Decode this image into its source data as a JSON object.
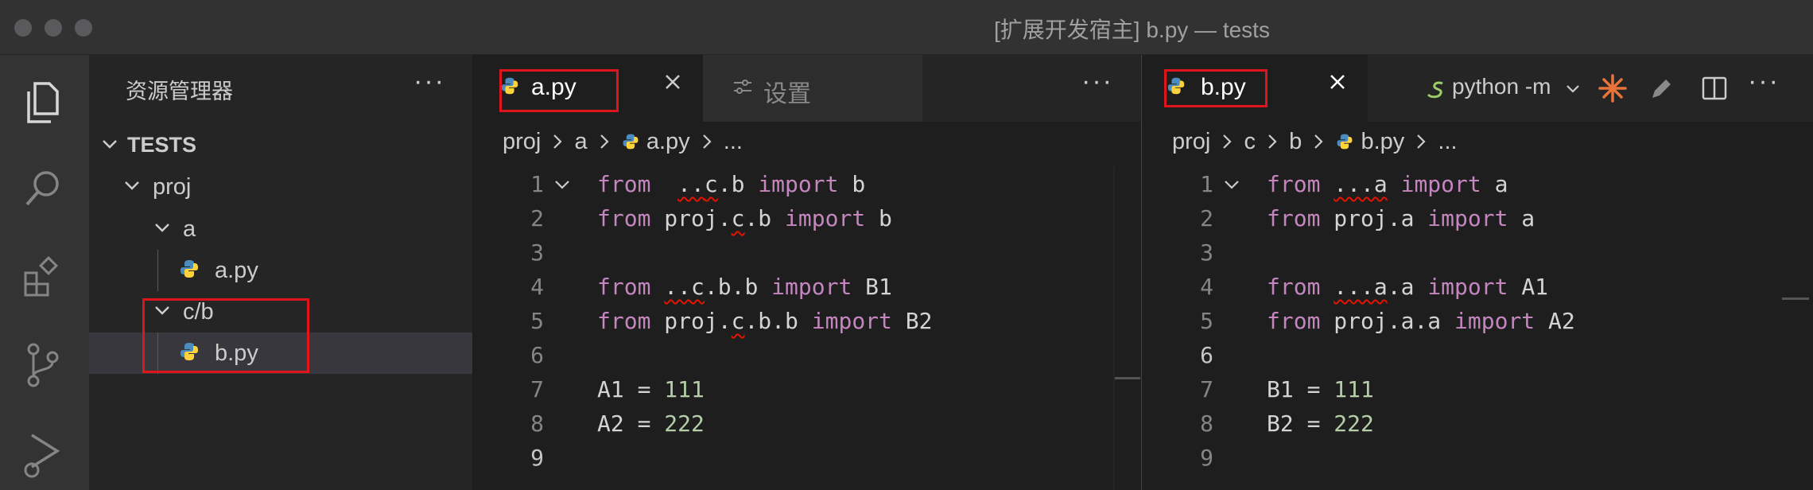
{
  "window": {
    "title": "[扩展开发宿主] b.py — tests"
  },
  "activity_bar": {
    "icons": [
      "files-icon",
      "search-icon",
      "extensions-icon",
      "source-control-icon",
      "run-debug-icon"
    ]
  },
  "sidebar": {
    "title": "资源管理器",
    "more": "···",
    "root": "TESTS",
    "tree": {
      "proj": "proj",
      "a": "a",
      "a_py": "a.py",
      "cb": "c/b",
      "b_py": "b.py"
    }
  },
  "left_editor": {
    "tabs": [
      {
        "label": "a.py",
        "active": true,
        "icon": "python-icon"
      },
      {
        "label": "设置",
        "active": false,
        "icon": "settings-sliders-icon"
      }
    ],
    "more": "···",
    "breadcrumb": [
      "proj",
      "a",
      "a.py",
      "..."
    ],
    "lines": [
      {
        "n": "1",
        "parts": [
          [
            "kw",
            "from"
          ],
          [
            "",
            "  "
          ],
          [
            "sq",
            ".."
          ],
          [
            "sq",
            "c"
          ],
          [
            "",
            ".b "
          ],
          [
            "kw",
            "import"
          ],
          [
            "",
            " b"
          ]
        ]
      },
      {
        "n": "2",
        "parts": [
          [
            "kw",
            "from"
          ],
          [
            "",
            " proj."
          ],
          [
            "sq",
            "c"
          ],
          [
            "",
            ".b "
          ],
          [
            "kw",
            "import"
          ],
          [
            "",
            " b"
          ]
        ]
      },
      {
        "n": "3",
        "parts": []
      },
      {
        "n": "4",
        "parts": [
          [
            "kw",
            "from"
          ],
          [
            "",
            " "
          ],
          [
            "sq",
            ".."
          ],
          [
            "sq",
            "c"
          ],
          [
            "",
            ".b.b "
          ],
          [
            "kw",
            "import"
          ],
          [
            "",
            " B1"
          ]
        ]
      },
      {
        "n": "5",
        "parts": [
          [
            "kw",
            "from"
          ],
          [
            "",
            " proj."
          ],
          [
            "sq",
            "c"
          ],
          [
            "",
            ".b.b "
          ],
          [
            "kw",
            "import"
          ],
          [
            "",
            " B2"
          ]
        ]
      },
      {
        "n": "6",
        "parts": []
      },
      {
        "n": "7",
        "parts": [
          [
            "",
            "A1 = "
          ],
          [
            "num",
            "111"
          ]
        ]
      },
      {
        "n": "8",
        "parts": [
          [
            "",
            "A2 = "
          ],
          [
            "num",
            "222"
          ]
        ]
      },
      {
        "n": "9",
        "parts": []
      }
    ]
  },
  "right_editor": {
    "tabs": [
      {
        "label": "b.py",
        "active": true,
        "icon": "python-icon"
      }
    ],
    "run_label": "python -m",
    "more": "···",
    "breadcrumb": [
      "proj",
      "c",
      "b",
      "b.py",
      "..."
    ],
    "lines": [
      {
        "n": "1",
        "parts": [
          [
            "kw",
            "from"
          ],
          [
            "",
            " "
          ],
          [
            "sq",
            "...a"
          ],
          [
            "",
            " "
          ],
          [
            "kw",
            "import"
          ],
          [
            "",
            " a"
          ]
        ]
      },
      {
        "n": "2",
        "parts": [
          [
            "kw",
            "from"
          ],
          [
            "",
            " proj.a "
          ],
          [
            "kw",
            "import"
          ],
          [
            "",
            " a"
          ]
        ]
      },
      {
        "n": "3",
        "parts": []
      },
      {
        "n": "4",
        "parts": [
          [
            "kw",
            "from"
          ],
          [
            "",
            " "
          ],
          [
            "sq",
            "...a"
          ],
          [
            "",
            ".a "
          ],
          [
            "kw",
            "import"
          ],
          [
            "",
            " A1"
          ]
        ]
      },
      {
        "n": "5",
        "parts": [
          [
            "kw",
            "from"
          ],
          [
            "",
            " proj.a.a "
          ],
          [
            "kw",
            "import"
          ],
          [
            "",
            " A2"
          ]
        ]
      },
      {
        "n": "6",
        "parts": []
      },
      {
        "n": "7",
        "parts": [
          [
            "",
            "B1 = "
          ],
          [
            "num",
            "111"
          ]
        ]
      },
      {
        "n": "8",
        "parts": [
          [
            "",
            "B2 = "
          ],
          [
            "num",
            "222"
          ]
        ]
      },
      {
        "n": "9",
        "parts": []
      }
    ]
  },
  "colors": {
    "keyword": "#c586c0",
    "number": "#b5cea8",
    "annotation_box": "#e0151b",
    "squiggle": "#e51400"
  }
}
